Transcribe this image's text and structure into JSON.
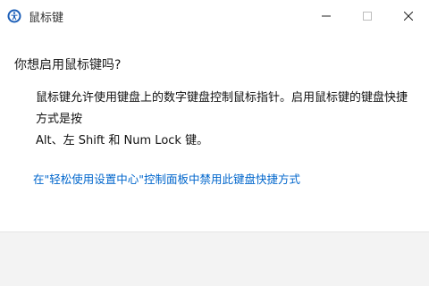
{
  "window": {
    "title": "鼠标键",
    "controls": {
      "minimize": "—",
      "maximize": "☐",
      "close": "✕"
    }
  },
  "dialog": {
    "question": "你想启用鼠标键吗?",
    "description_line1": "鼠标键允许使用键盘上的数字键盘控制鼠标指针。启用鼠标键的键盘快捷方式是按",
    "description_line2": "Alt、左 Shift 和 Num Lock 键。",
    "link": "在\"轻松使用设置中心\"控制面板中禁用此键盘快捷方式"
  },
  "colors": {
    "link": "#0066cc",
    "footer": "#f3f3f3"
  },
  "icons": {
    "app": "ease-of-access-icon"
  }
}
